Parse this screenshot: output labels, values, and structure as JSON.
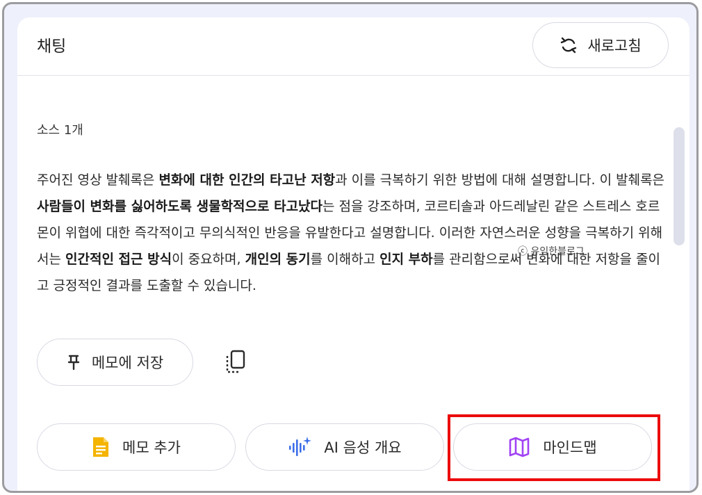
{
  "header": {
    "title": "채팅",
    "refresh_label": "새로고침"
  },
  "sources": {
    "label": "소스 1개"
  },
  "response": {
    "segments": [
      {
        "text": "주어진 영상 발췌록은 ",
        "bold": false
      },
      {
        "text": "변화에 대한 인간의 타고난 저항",
        "bold": true
      },
      {
        "text": "과 이를 극복하기 위한 방법에 대해 설명합니다. 이 발췌록은 ",
        "bold": false
      },
      {
        "text": "사람들이 변화를 싫어하도록 생물학적으로 타고났다",
        "bold": true
      },
      {
        "text": "는 점을 강조하며, 코르티솔과 아드레날린 같은 스트레스 호르몬이 위협에 대한 즉각적이고 무의식적인 반응을 유발한다고 설명합니다. 이러한 자연스러운 성향을 극복하기 위해서는 ",
        "bold": false
      },
      {
        "text": "인간적인 접근 방식",
        "bold": true
      },
      {
        "text": "이 중요하며, ",
        "bold": false
      },
      {
        "text": "개인의 동기",
        "bold": true
      },
      {
        "text": "를 이해하고 ",
        "bold": false
      },
      {
        "text": "인지 부하",
        "bold": true
      },
      {
        "text": "를 관리함으로써 변화에 대한 저항을 줄이고 긍정적인 결과를 도출할 수 있습니다.",
        "bold": false
      }
    ]
  },
  "watermark": {
    "text": "ⓒ 유익한블로그"
  },
  "actions": {
    "save_note_label": "메모에 저장",
    "add_note_label": "메모 추가",
    "audio_overview_label": "AI 음성 개요",
    "mindmap_label": "마인드맵"
  },
  "icons": {
    "refresh": "refresh-icon",
    "pin": "pin-icon",
    "copy": "copy-icon",
    "note": "note-icon",
    "audio": "audio-wave-icon",
    "map": "map-icon"
  },
  "colors": {
    "note_icon": "#f4b400",
    "audio_icon": "#3b6ee8",
    "map_icon": "#a142f4",
    "highlight": "#ec0b0b"
  }
}
